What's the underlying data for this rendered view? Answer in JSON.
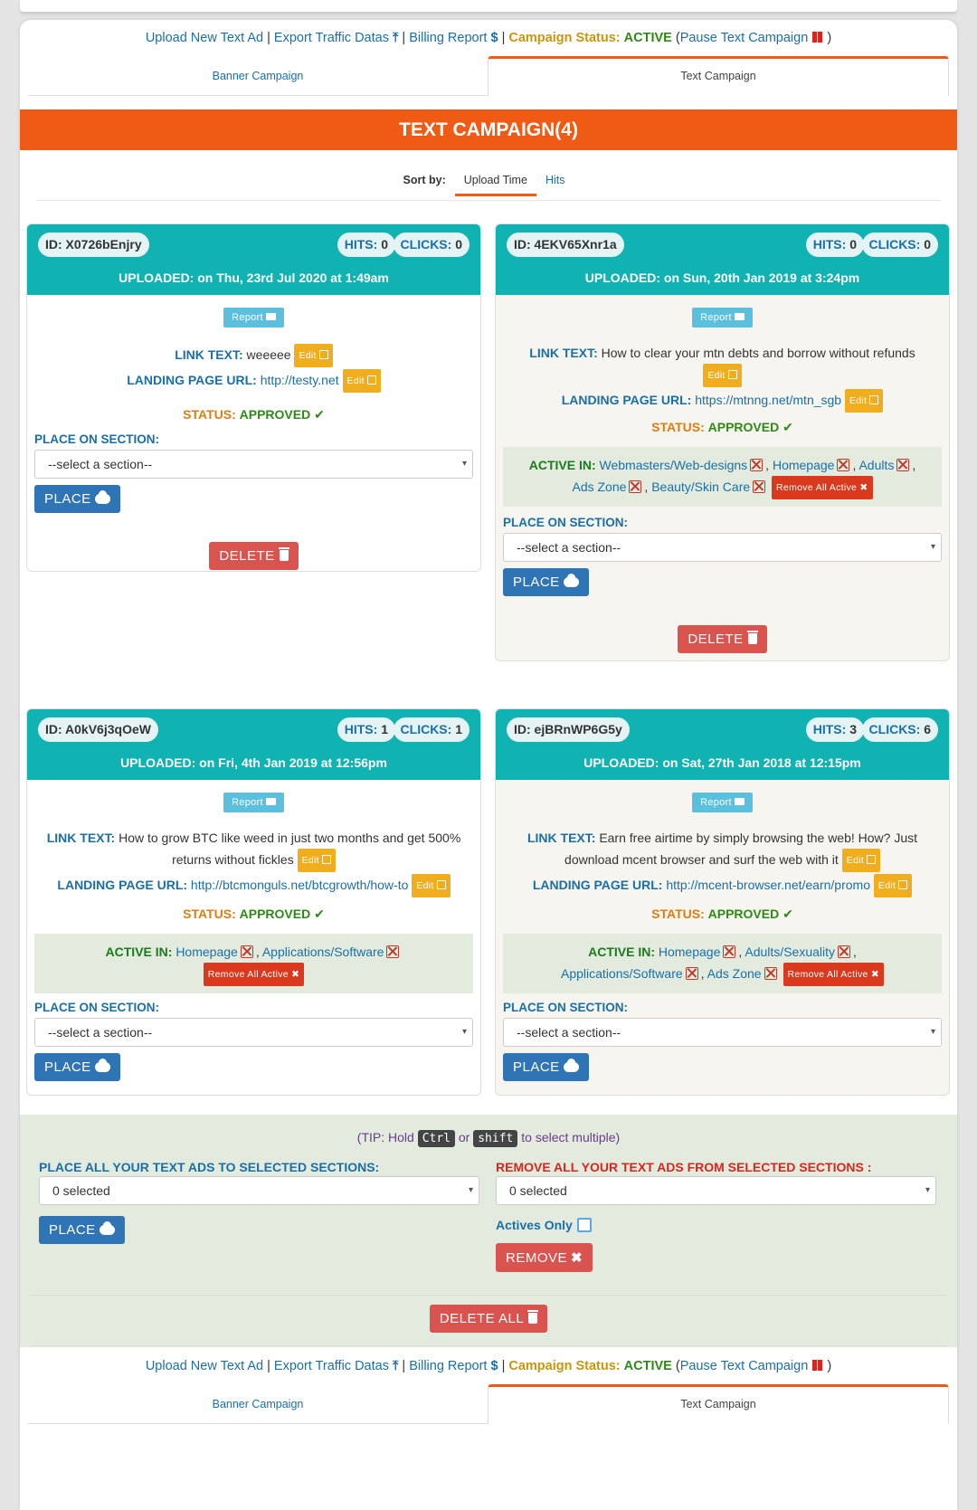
{
  "top_links": {
    "upload": "Upload New Text Ad",
    "export": "Export Traffic Datas",
    "export_icon": "⤒",
    "billing": "Billing Report",
    "billing_icon": "$",
    "status_label": "Campaign Status:",
    "status_value": "ACTIVE",
    "pause": "Pause Text Campaign"
  },
  "tabs": [
    "Banner Campaign",
    "Text Campaign"
  ],
  "header_title": "TEXT CAMPAIGN(4)",
  "sort": {
    "label": "Sort by:",
    "options": [
      "Upload Time",
      "Hits"
    ]
  },
  "labels": {
    "report": "Report",
    "link_text": "LINK TEXT:",
    "landing": "LANDING PAGE URL:",
    "edit": "Edit",
    "status": "STATUS:",
    "approved": "APPROVED",
    "active_in": "ACTIVE IN:",
    "remove_all": "Remove All Active",
    "place_on": "PLACE ON SECTION:",
    "select_placeholder": "--select a section--",
    "place": "PLACE",
    "delete": "DELETE",
    "hits": "HITS:",
    "clicks": "CLICKS:"
  },
  "ads": [
    {
      "id": "ID: X0726bEnjry",
      "hits": "0",
      "clicks": "0",
      "uploaded": "UPLOADED: on Thu, 23rd Jul 2020 at 1:49am",
      "link_text": "weeeee",
      "url": "http://testy.net",
      "active_in": []
    },
    {
      "id": "ID: 4EKV65Xnr1a",
      "hits": "0",
      "clicks": "0",
      "uploaded": "UPLOADED: on Sun, 20th Jan 2019 at 3:24pm",
      "link_text": "How to clear your mtn debts and borrow without refunds",
      "url": "https://mtnng.net/mtn_sgb",
      "active_in": [
        "Webmasters/Web-designs",
        "Homepage",
        "Adults",
        "Ads Zone",
        "Beauty/Skin Care"
      ]
    },
    {
      "id": "ID: A0kV6j3qOeW",
      "hits": "1",
      "clicks": "1",
      "uploaded": "UPLOADED: on Fri, 4th Jan 2019 at 12:56pm",
      "link_text": "How to grow BTC like weed in just two months and get 500% returns without fickles",
      "url": "http://btcmonguls.net/btcgrowth/how-to",
      "active_in": [
        "Homepage",
        "Applications/Software"
      ]
    },
    {
      "id": "ID: ejBRnWP6G5y",
      "hits": "3",
      "clicks": "6",
      "uploaded": "UPLOADED: on Sat, 27th Jan 2018 at 12:15pm",
      "link_text": "Earn free airtime by simply browsing the web! How? Just download mcent browser and surf the web with it",
      "url": "http://mcent-browser.net/earn/promo",
      "active_in": [
        "Homepage",
        "Adults/Sexuality",
        "Applications/Software",
        "Ads Zone"
      ]
    }
  ],
  "bulk": {
    "tip_pre": "(TIP: Hold",
    "tip_key1": "Ctrl",
    "tip_or": "or",
    "tip_key2": "shift",
    "tip_post": "to select multiple)",
    "place_all_label": "PLACE ALL YOUR TEXT ADS TO SELECTED SECTIONS:",
    "remove_all_label": "REMOVE ALL YOUR TEXT ADS FROM SELECTED SECTIONS :",
    "selected": "0 selected",
    "actives_only": "Actives Only",
    "remove": "REMOVE",
    "delete_all": "DELETE ALL"
  }
}
